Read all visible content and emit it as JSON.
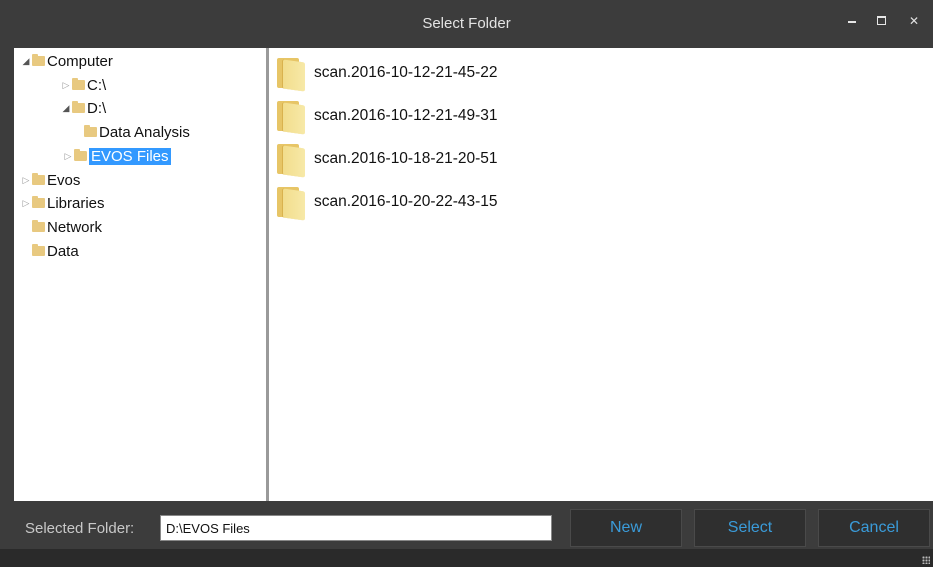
{
  "window": {
    "title": "Select Folder",
    "controls": {
      "minimize": "–",
      "maximize": "□",
      "close": "✕"
    }
  },
  "tree": {
    "nodes": [
      {
        "label": "Computer",
        "expander": "expanded",
        "icon": "folder-icon"
      },
      {
        "label": "C:\\",
        "expander": "collapsed",
        "icon": "folder-icon"
      },
      {
        "label": "D:\\",
        "expander": "expanded",
        "icon": "folder-icon"
      },
      {
        "label": "Data Analysis",
        "expander": "none",
        "icon": "folder-icon"
      },
      {
        "label": "EVOS Files",
        "expander": "collapsed",
        "icon": "folder-icon",
        "selected": true
      },
      {
        "label": "Evos",
        "expander": "collapsed",
        "icon": "folder-icon"
      },
      {
        "label": "Libraries",
        "expander": "collapsed",
        "icon": "folder-icon"
      },
      {
        "label": "Network",
        "expander": "none",
        "icon": "folder-icon"
      },
      {
        "label": "Data",
        "expander": "none",
        "icon": "folder-icon"
      }
    ]
  },
  "files": [
    {
      "name": "scan.2016-10-12-21-45-22",
      "icon": "folder-icon"
    },
    {
      "name": "scan.2016-10-12-21-49-31",
      "icon": "folder-icon"
    },
    {
      "name": "scan.2016-10-18-21-20-51",
      "icon": "folder-icon"
    },
    {
      "name": "scan.2016-10-20-22-43-15",
      "icon": "folder-icon"
    }
  ],
  "footer": {
    "selected_label": "Selected Folder:",
    "selected_value": "D:\\EVOS Files",
    "new_label": "New",
    "select_label": "Select",
    "cancel_label": "Cancel"
  },
  "colors": {
    "chrome": "#3c3c3c",
    "selection": "#3399ff",
    "button_text": "#3a9bd9",
    "folder": "#e8c980"
  }
}
